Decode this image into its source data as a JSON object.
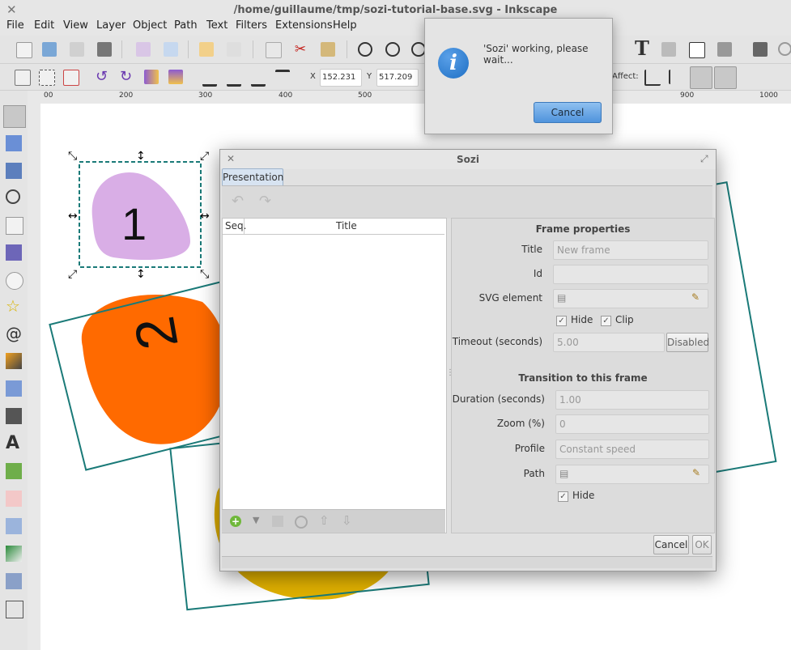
{
  "window": {
    "title": "/home/guillaume/tmp/sozi-tutorial-base.svg - Inkscape",
    "close_glyph": "✕"
  },
  "menu": [
    "File",
    "Edit",
    "View",
    "Layer",
    "Object",
    "Path",
    "Text",
    "Filters",
    "Extensions",
    "Help"
  ],
  "controls": {
    "x_label": "X",
    "x_value": "152.231",
    "y_label": "Y",
    "y_value": "517.209",
    "affect_label": "Affect:"
  },
  "ruler_ticks": [
    "00",
    "200",
    "300",
    "400",
    "500",
    "900",
    "1000"
  ],
  "canvas": {
    "shape1_label": "1",
    "shape2_label": "2"
  },
  "info_dialog": {
    "message": "'Sozi' working, please wait...",
    "cancel_label": "Cancel"
  },
  "sozi": {
    "title": "Sozi",
    "close_glyph": "✕",
    "tab": "Presentation",
    "columns": {
      "seq": "Seq.",
      "title": "Title"
    },
    "frame_properties": {
      "heading": "Frame properties",
      "title_label": "Title",
      "title_placeholder": "New frame",
      "id_label": "Id",
      "svg_label": "SVG element",
      "hide_label": "Hide",
      "clip_label": "Clip",
      "timeout_label": "Timeout (seconds)",
      "timeout_value": "5.00",
      "disabled_label": "Disabled"
    },
    "transition": {
      "heading": "Transition to this frame",
      "duration_label": "Duration (seconds)",
      "duration_value": "1.00",
      "zoom_label": "Zoom (%)",
      "zoom_value": "0",
      "profile_label": "Profile",
      "profile_value": "Constant speed",
      "path_label": "Path",
      "hide_label": "Hide"
    },
    "cancel_label": "Cancel",
    "ok_label": "OK"
  },
  "colors": {
    "accent_blue": "#1e6fc4",
    "teal": "#1a7a78",
    "orange": "#ff6a00",
    "lilac": "#d9aee6",
    "yellow": "#e0b000"
  }
}
